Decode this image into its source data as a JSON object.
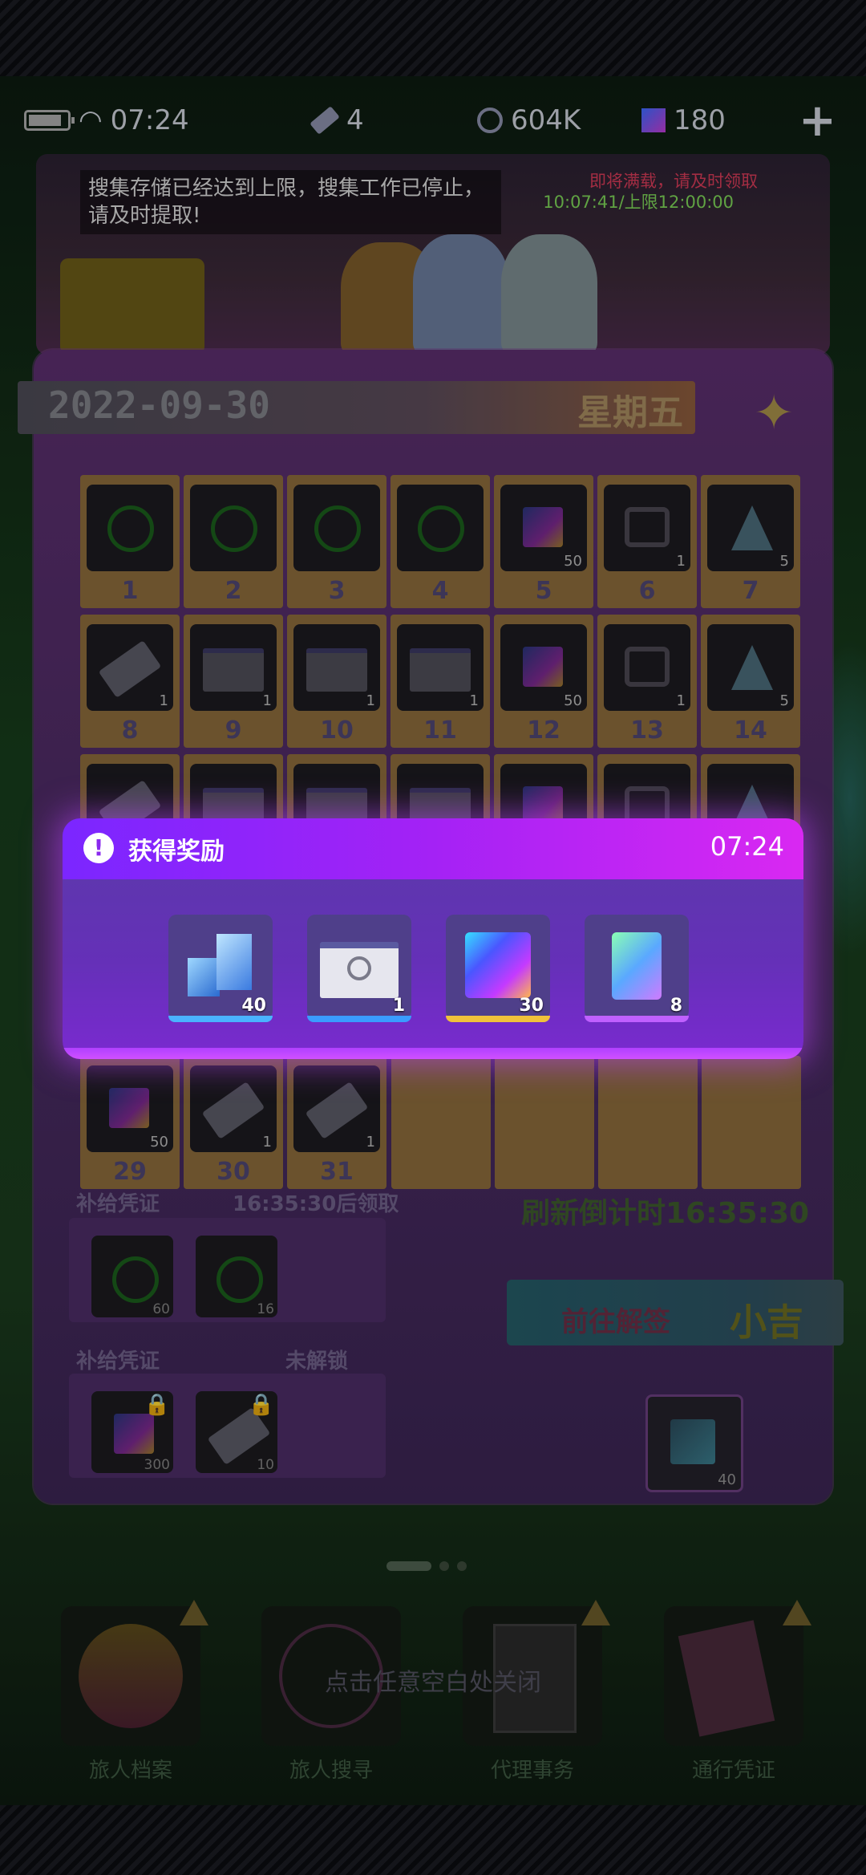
{
  "status_bar": {
    "time": "07:24",
    "ticket_count": "4",
    "coin_count": "604K",
    "gem_count": "180",
    "add_label": "+"
  },
  "banner": {
    "notice": "搜集存储已经达到上限，搜集工作已停止，请及时提取!",
    "warn": "即将满载，请及时领取",
    "timer": "10:07:41/上限12:00:00"
  },
  "calendar": {
    "date": "2022-09-30",
    "weekday": "星期五",
    "days": [
      {
        "day": "1",
        "icon": "ring-icon",
        "count": ""
      },
      {
        "day": "2",
        "icon": "ring-icon",
        "count": ""
      },
      {
        "day": "3",
        "icon": "ring-icon",
        "count": ""
      },
      {
        "day": "4",
        "icon": "ring-icon",
        "count": ""
      },
      {
        "day": "5",
        "icon": "cube-icon",
        "count": "50"
      },
      {
        "day": "6",
        "icon": "hex-icon",
        "count": "1"
      },
      {
        "day": "7",
        "icon": "crystal-icon",
        "count": "5"
      },
      {
        "day": "8",
        "icon": "ticket-icon",
        "count": "1"
      },
      {
        "day": "9",
        "icon": "xp-card-icon",
        "count": "1"
      },
      {
        "day": "10",
        "icon": "card-icon",
        "count": "1"
      },
      {
        "day": "11",
        "icon": "card-icon",
        "count": "1"
      },
      {
        "day": "12",
        "icon": "cube-icon",
        "count": "50"
      },
      {
        "day": "13",
        "icon": "hex-icon",
        "count": "1"
      },
      {
        "day": "14",
        "icon": "crystal-icon",
        "count": "5"
      },
      {
        "day": "",
        "icon": "ticket-icon",
        "count": ""
      },
      {
        "day": "",
        "icon": "xp-card-icon",
        "count": ""
      },
      {
        "day": "",
        "icon": "card-icon",
        "count": ""
      },
      {
        "day": "",
        "icon": "card-icon",
        "count": ""
      },
      {
        "day": "",
        "icon": "cube-icon",
        "count": ""
      },
      {
        "day": "",
        "icon": "hex-icon",
        "count": ""
      },
      {
        "day": "",
        "icon": "crystal-icon",
        "count": ""
      },
      {
        "day": "29",
        "icon": "cube-icon",
        "count": "50"
      },
      {
        "day": "30",
        "icon": "ticket-icon",
        "count": "1"
      },
      {
        "day": "31",
        "icon": "ticket-icon",
        "count": "1"
      }
    ]
  },
  "supply": {
    "label1": "补给凭证",
    "claim_timer": "16:35:30后领取",
    "slot1_count": "60",
    "slot2_count": "16",
    "label2": "补给凭证",
    "locked_label": "未解锁",
    "slot3_count": "300",
    "slot4_count": "10",
    "refresh_countdown": "刷新倒计时16:35:30",
    "goto_label": "前往解签",
    "luck_label": "小吉",
    "bonus_count": "40"
  },
  "dialog": {
    "title": "获得奖励",
    "time": "07:24",
    "rewards": [
      {
        "icon": "blocks-icon",
        "count": "40",
        "accent": "#4ab3ff"
      },
      {
        "icon": "card-icon",
        "count": "1",
        "accent": "#3a9cff"
      },
      {
        "icon": "cube-icon",
        "count": "30",
        "accent": "#f0c23a"
      },
      {
        "icon": "hourglass-icon",
        "count": "8",
        "accent": "#c060ff"
      }
    ]
  },
  "nav": {
    "items": [
      {
        "label": "旅人档案"
      },
      {
        "label": "旅人搜寻"
      },
      {
        "label": "代理事务"
      },
      {
        "label": "通行凭证"
      }
    ],
    "tap_hint": "点击任意空白处关闭"
  },
  "colors": {
    "accent": "#a422f5",
    "dialog_glow": "#be46ff"
  }
}
